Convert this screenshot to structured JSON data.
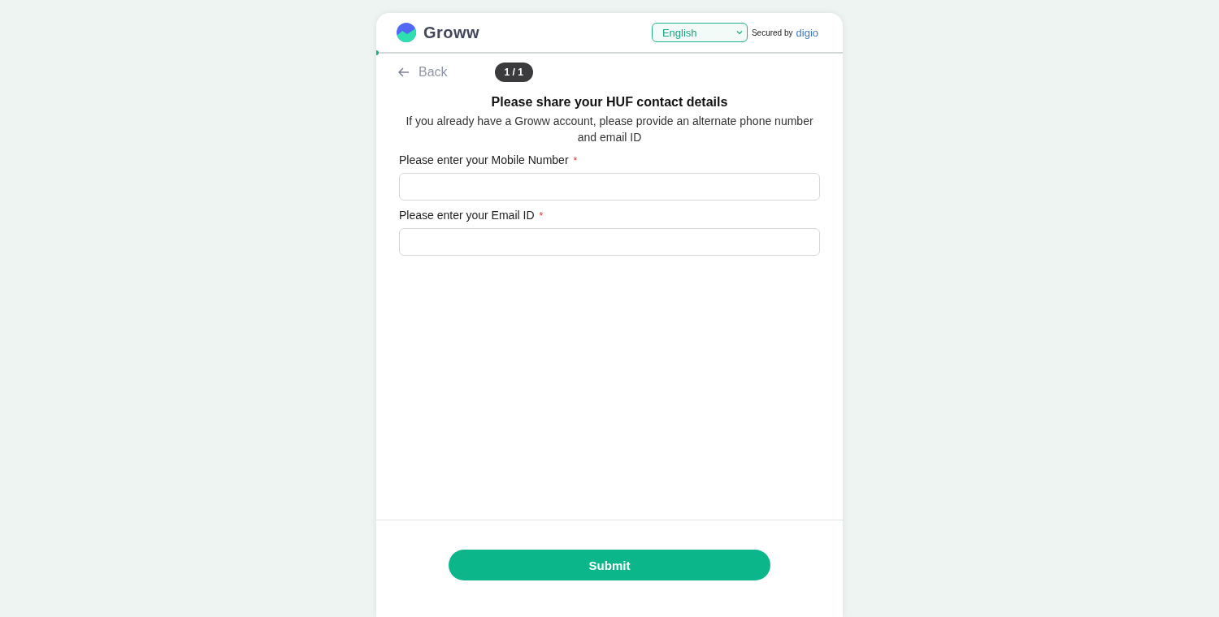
{
  "header": {
    "brand": "Groww",
    "language": {
      "value": "English"
    },
    "secured_by": "Secured by",
    "provider": "digio"
  },
  "progress": {
    "level": 0
  },
  "nav": {
    "back": "Back",
    "step": "1 / 1"
  },
  "form": {
    "title": "Please share your HUF contact details",
    "subtitle": "If you already have a Groww account, please provide an alternate phone number and email ID",
    "fields": [
      {
        "label": "Please enter your Mobile Number",
        "required_mark": "*"
      },
      {
        "label": "Please enter your Email ID",
        "required_mark": "*"
      }
    ]
  },
  "submit": "Submit"
}
